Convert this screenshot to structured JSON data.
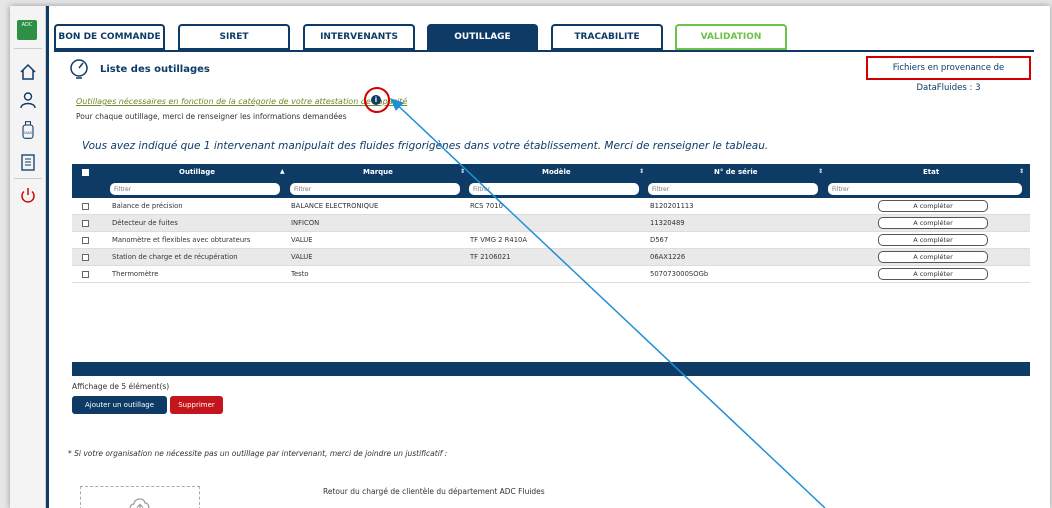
{
  "sidebar": {
    "logo_text": "ADC",
    "icons": [
      "home-icon",
      "user-icon",
      "gas-bottle-icon",
      "clipboard-icon",
      "power-icon"
    ]
  },
  "tabs": [
    {
      "label": "BON DE COMMANDE",
      "state": "normal"
    },
    {
      "label": "SIRET",
      "state": "normal"
    },
    {
      "label": "INTERVENANTS",
      "state": "normal"
    },
    {
      "label": "OUTILLAGE",
      "state": "active"
    },
    {
      "label": "TRACABILITE",
      "state": "normal"
    },
    {
      "label": "VALIDATION",
      "state": "valid"
    }
  ],
  "section": {
    "title": "Liste des outillages",
    "datafluides": "Fichiers en provenance de DataFluides : 3",
    "link_text": "Outillages nécessaires en fonction de la catégorie de votre attestation de capacité",
    "info_glyph": "i",
    "subtitle": "Pour chaque outillage, merci de renseigner les informations demandées",
    "banner": "Vous avez indiqué que 1 intervenant manipulait des fluides frigorigènes dans votre établissement. Merci de renseigner le tableau."
  },
  "table": {
    "columns": [
      "Outillage",
      "Marque",
      "Modèle",
      "N° de série",
      "Etat"
    ],
    "sort_glyphs": [
      "▲",
      "⇕",
      "⇕",
      "⇕",
      "⇕"
    ],
    "filter_placeholder": "Filtrer",
    "rows": [
      {
        "outillage": "Balance de précision",
        "marque": "BALANCE ELECTRONIQUE",
        "modele": "RCS 7010",
        "serie": "B120201113",
        "etat": "A compléter"
      },
      {
        "outillage": "Détecteur de fuites",
        "marque": "INFICON",
        "modele": "",
        "serie": "11320489",
        "etat": "A compléter"
      },
      {
        "outillage": "Manomètre et flexibles avec obturateurs",
        "marque": "VALUE",
        "modele": "TF VMG 2 R410A",
        "serie": "D567",
        "etat": "A compléter"
      },
      {
        "outillage": "Station de charge et de récupération",
        "marque": "VALUE",
        "modele": "TF 2106021",
        "serie": "06AX1226",
        "etat": "A compléter"
      },
      {
        "outillage": "Thermomètre",
        "marque": "Testo",
        "modele": "",
        "serie": "507073000SOGb",
        "etat": "A compléter"
      }
    ]
  },
  "footer": {
    "affichage": "Affichage de 5 élément(s)",
    "add_label": "Ajouter un outillage",
    "delete_label": "Supprimer",
    "note": "* Si votre organisation ne nécessite pas un outillage par intervenant, merci de joindre un justificatif :",
    "retour": "Retour du chargé de clientèle du département ADC Fluides"
  },
  "colors": {
    "navy": "#0e3b66",
    "red": "#d40000",
    "green": "#6cc24a",
    "annotation_arrow": "#1f8fd6"
  }
}
